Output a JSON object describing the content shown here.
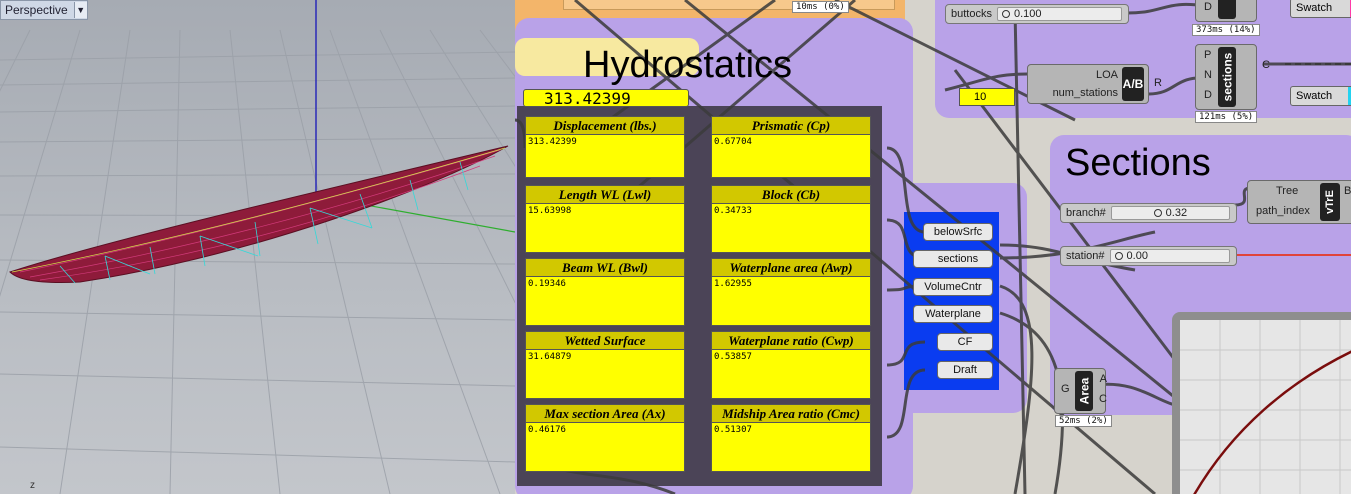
{
  "viewport": {
    "tab_label": "Perspective",
    "axis_label": "z"
  },
  "hydrostatics": {
    "title": "Hydrostatics",
    "main_value": "313.42399",
    "panels": [
      {
        "label": "Displacement (lbs.)",
        "value": "313.42399"
      },
      {
        "label": "Prismatic (Cp)",
        "value": "0.67704"
      },
      {
        "label": "Length WL (Lwl)",
        "value": "15.63998"
      },
      {
        "label": "Block (Cb)",
        "value": "0.34733"
      },
      {
        "label": "Beam WL (Bwl)",
        "value": "0.19346"
      },
      {
        "label": "Waterplane area (Awp)",
        "value": "1.62955"
      },
      {
        "label": "Wetted Surface",
        "value": "31.64879"
      },
      {
        "label": "Waterplane ratio (Cwp)",
        "value": "0.53857"
      },
      {
        "label": "Max section Area (Ax)",
        "value": "0.46176"
      },
      {
        "label": "Midship Area ratio (Cmc)",
        "value": "0.51307"
      }
    ]
  },
  "outputs": {
    "items": [
      "belowSrfc",
      "sections",
      "VolumeCntr",
      "Waterplane",
      "CF",
      "Draft"
    ]
  },
  "top": {
    "timing_top": "10ms (0%)",
    "buttocks_label": "buttocks",
    "buttocks_value": "0.100",
    "timing_d": "373ms (14%)",
    "swatch_label": "Swatch",
    "swatch2_label": "Swatch",
    "loa_label": "LOA",
    "num_stations_label": "num_stations",
    "ab_label": "A/B",
    "r_label": "R",
    "num_stations_value": "10",
    "sections_comp": "sections",
    "sections_inputs": [
      "P",
      "N",
      "D"
    ],
    "sections_output": "C",
    "d_label": "D",
    "timing_sections": "121ms (5%)"
  },
  "sections_group": {
    "title": "Sections",
    "branch_label": "branch#",
    "branch_value": "0.32",
    "station_label": "station#",
    "station_value": "0.00",
    "tree_label": "Tree",
    "path_index_label": "path_index",
    "vtre_label": "vTrE",
    "br_label": "Br"
  },
  "area": {
    "label": "Area",
    "input": "G",
    "out_a": "A",
    "out_c": "C",
    "timing": "52ms (2%)"
  },
  "colors": {
    "group_purple": "#b9a2e8",
    "group_orange": "#f3b56a",
    "panel_yellow": "#ffff00",
    "panel_header": "#d2c800",
    "dark_group": "#4b4457",
    "outputs_blue": "#0a3cf0"
  }
}
